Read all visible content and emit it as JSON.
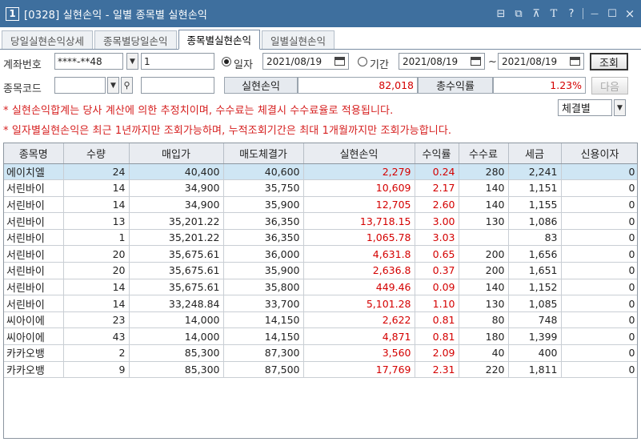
{
  "window": {
    "number": "1",
    "title": "[0328] 실현손익 - 일별 종목별 실현손익",
    "icons": [
      "layout-icon",
      "restore-icon",
      "pin-icon",
      "font-icon",
      "help-icon",
      "minimize-icon",
      "maximize-icon",
      "close-icon"
    ],
    "icon_glyphs": {
      "layout": "⊟",
      "restore": "⧉",
      "pin": "⊼",
      "font": "T",
      "help": "?",
      "minimize": "—",
      "maximize": "☐",
      "close": "×"
    }
  },
  "tabs": [
    {
      "label": "당일실현손익상세",
      "active": false
    },
    {
      "label": "종목별당일손익",
      "active": false
    },
    {
      "label": "종목별실현손익",
      "active": true
    },
    {
      "label": "일별실현손익",
      "active": false
    }
  ],
  "filters": {
    "account_label": "계좌번호",
    "account_value": "****-**48",
    "account_seq": "1",
    "date_radio_label": "일자",
    "date_value": "2021/08/19",
    "period_radio_label": "기간",
    "period_from": "2021/08/19",
    "period_to": "2021/08/19",
    "period_sep": "~",
    "query_button": "조회",
    "code_label": "종목코드",
    "code_value": "",
    "name_value": "",
    "next_button": "다음"
  },
  "summary": {
    "pnl_label": "실현손익",
    "pnl_value": "82,018",
    "return_label": "총수익률",
    "return_value": "1.23%"
  },
  "notices": [
    "* 실현손익합계는 당사 계산에 의한 추정치이며, 수수료는 체결시 수수료율로 적용됩니다.",
    "* 일자별실현손익은 최근 1년까지만 조회가능하며, 누적조회기간은 최대 1개월까지만 조회가능합니다."
  ],
  "view_select": "체결별",
  "colors": {
    "title_bg": "#3e6f9e",
    "red": "#d40000",
    "selected_row": "#cfe6f4"
  },
  "table": {
    "columns": [
      "종목명",
      "수량",
      "매입가",
      "매도체결가",
      "실현손익",
      "수익률",
      "수수료",
      "세금",
      "신용이자"
    ],
    "rows": [
      [
        "에이치엘",
        "24",
        "40,400",
        "40,600",
        "2,279",
        "0.24",
        "280",
        "2,241",
        "0"
      ],
      [
        "서린바이",
        "14",
        "34,900",
        "35,750",
        "10,609",
        "2.17",
        "140",
        "1,151",
        "0"
      ],
      [
        "서린바이",
        "14",
        "34,900",
        "35,900",
        "12,705",
        "2.60",
        "140",
        "1,155",
        "0"
      ],
      [
        "서린바이",
        "13",
        "35,201.22",
        "36,350",
        "13,718.15",
        "3.00",
        "130",
        "1,086",
        "0"
      ],
      [
        "서린바이",
        "1",
        "35,201.22",
        "36,350",
        "1,065.78",
        "3.03",
        "",
        "83",
        "0"
      ],
      [
        "서린바이",
        "20",
        "35,675.61",
        "36,000",
        "4,631.8",
        "0.65",
        "200",
        "1,656",
        "0"
      ],
      [
        "서린바이",
        "20",
        "35,675.61",
        "35,900",
        "2,636.8",
        "0.37",
        "200",
        "1,651",
        "0"
      ],
      [
        "서린바이",
        "14",
        "35,675.61",
        "35,800",
        "449.46",
        "0.09",
        "140",
        "1,152",
        "0"
      ],
      [
        "서린바이",
        "14",
        "33,248.84",
        "33,700",
        "5,101.28",
        "1.10",
        "130",
        "1,085",
        "0"
      ],
      [
        "씨아이에",
        "23",
        "14,000",
        "14,150",
        "2,622",
        "0.81",
        "80",
        "748",
        "0"
      ],
      [
        "씨아이에",
        "43",
        "14,000",
        "14,150",
        "4,871",
        "0.81",
        "180",
        "1,399",
        "0"
      ],
      [
        "카카오뱅",
        "2",
        "85,300",
        "87,300",
        "3,560",
        "2.09",
        "40",
        "400",
        "0"
      ],
      [
        "카카오뱅",
        "9",
        "85,300",
        "87,500",
        "17,769",
        "2.31",
        "220",
        "1,811",
        "0"
      ]
    ]
  }
}
